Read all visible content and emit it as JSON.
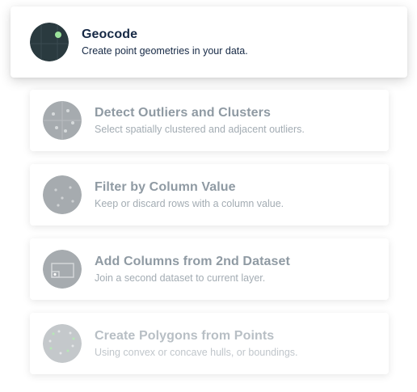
{
  "options": [
    {
      "title": "Geocode",
      "description": "Create point geometries in your data.",
      "icon": "geocode-icon"
    },
    {
      "title": "Detect Outliers and Clusters",
      "description": "Select spatially clustered and adjacent outliers.",
      "icon": "outliers-clusters-icon"
    },
    {
      "title": "Filter by Column Value",
      "description": "Keep or discard rows with a column value.",
      "icon": "filter-column-icon"
    },
    {
      "title": "Add Columns from 2nd Dataset",
      "description": "Join a second dataset to current layer.",
      "icon": "join-dataset-icon"
    },
    {
      "title": "Create Polygons from Points",
      "description": "Using convex or concave hulls, or boundings.",
      "icon": "polygons-points-icon"
    }
  ],
  "colors": {
    "active_icon_bg": "#2a3a3f",
    "accent_green": "#9be29b",
    "inactive_icon_bg": "#a6abaf",
    "title_active": "#162945",
    "title_inactive": "#8f9aa3"
  }
}
